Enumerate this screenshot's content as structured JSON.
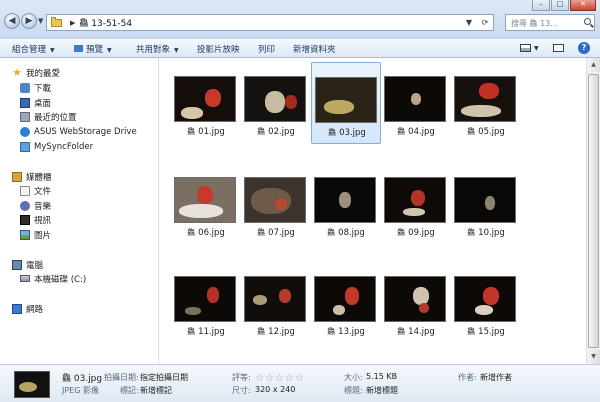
{
  "address": {
    "crumbs": [
      "鱻 13-51-54"
    ],
    "search_placeholder": "搜尋 鱻 13..."
  },
  "toolbar": {
    "organize": "組合管理",
    "preview": "預覽",
    "share": "共用對象",
    "slideshow": "投影片放映",
    "print": "列印",
    "new_folder": "新增資料夾"
  },
  "nav": {
    "favorites": "我的最愛",
    "downloads": "下載",
    "desktop": "桌面",
    "recent": "最近的位置",
    "asus": "ASUS WebStorage Drive",
    "sync": "MySyncFolder",
    "libraries": "媒體櫃",
    "documents": "文件",
    "music": "音樂",
    "videos": "視訊",
    "pictures": "圖片",
    "computer": "電腦",
    "local_disk": "本機磁碟 (C:)",
    "network": "網路"
  },
  "files": [
    {
      "name": "01.jpg"
    },
    {
      "name": "02.jpg"
    },
    {
      "name": "03.jpg"
    },
    {
      "name": "04.jpg"
    },
    {
      "name": "05.jpg"
    },
    {
      "name": "06.jpg"
    },
    {
      "name": "07.jpg"
    },
    {
      "name": "08.jpg"
    },
    {
      "name": "09.jpg"
    },
    {
      "name": "10.jpg"
    },
    {
      "name": "11.jpg"
    },
    {
      "name": "12.jpg"
    },
    {
      "name": "13.jpg"
    },
    {
      "name": "14.jpg"
    },
    {
      "name": "15.jpg"
    }
  ],
  "file_prefix": "鱻",
  "selected_index": 2,
  "details": {
    "filename": "鱻 03.jpg",
    "filetype": "JPEG 影像",
    "date_key": "拍攝日期:",
    "date_val": "指定拍攝日期",
    "tags_key": "標記:",
    "tags_val": "新增標記",
    "rating_key": "評等:",
    "dims_key": "尺寸:",
    "dims_val": "320 x 240",
    "size_key": "大小:",
    "size_val": "5.15 KB",
    "title_key": "標題:",
    "title_val": "新增標題",
    "author_key": "作者:",
    "author_val": "新增作者"
  },
  "colors": {
    "selection": "#d5e7fb",
    "toolbar_text": "#1e395b"
  }
}
